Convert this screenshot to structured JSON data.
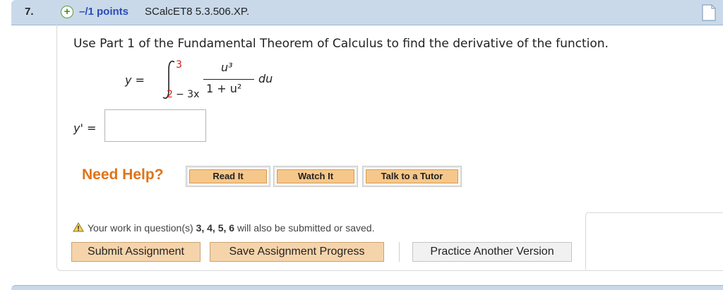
{
  "question": {
    "number": "7.",
    "points": "–/1 points",
    "code": "SCalcET8 5.3.506.XP."
  },
  "prompt": "Use Part 1 of the Fundamental Theorem of Calculus to find the derivative of the function.",
  "formula": {
    "lhs": "y =",
    "upper_limit": "3",
    "lower_limit_num": "2",
    "lower_limit_rest": "− 3x",
    "numerator": "u³",
    "denominator": "1 + u²",
    "differential": "du"
  },
  "answer": {
    "label": "y' =",
    "value": ""
  },
  "help": {
    "heading": "Need Help?",
    "buttons": [
      "Read It",
      "Watch It",
      "Talk to a Tutor"
    ]
  },
  "notice": {
    "prefix": "Your work in question(s)",
    "questions": "3, 4, 5, 6",
    "suffix": "will also be submitted or saved."
  },
  "actions": {
    "submit": "Submit Assignment",
    "save": "Save Assignment Progress",
    "practice": "Practice Another Version"
  },
  "colors": {
    "header_bg": "#c9d9ea",
    "points_blue": "#2a4bb8",
    "help_orange": "#e0731a",
    "limit_red": "#d0201a"
  }
}
